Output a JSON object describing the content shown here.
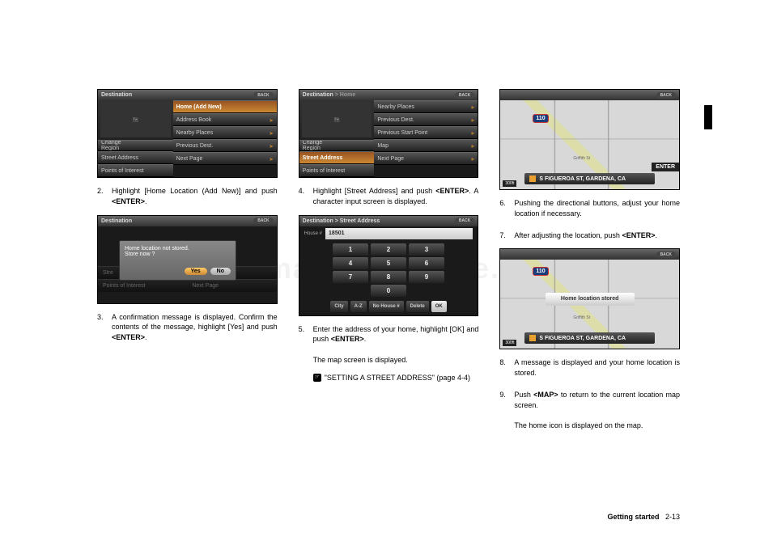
{
  "watermark": "carmanualsonline.info",
  "footer": {
    "section": "Getting started",
    "page": "2-13"
  },
  "col1": {
    "screenshot1": {
      "header_title": "Destination",
      "back": "BACK",
      "left_label": "Change\nRegion",
      "left_bottom1": "Street Address",
      "left_bottom2": "Points of Interest",
      "right": [
        "Home (Add New)",
        "Address Book",
        "Nearby Places",
        "Previous Dest.",
        "Next Page"
      ]
    },
    "step2": {
      "num": "2.",
      "txt_a": "Highlight [Home Location (Add New)] and push ",
      "btn": "<ENTER>",
      "txt_b": "."
    },
    "screenshot2": {
      "header_title": "Destination",
      "back": "BACK",
      "msg1": "Home location not stored.",
      "msg2": "Store now ?",
      "yes": "Yes",
      "no": "No",
      "dim1": "Stre",
      "dim2": "Points of Interest",
      "dim3": "Next Page"
    },
    "step3": {
      "num": "3.",
      "txt_a": "A confirmation message is displayed. Confirm the contents of the message, highlight [Yes] and push ",
      "btn": "<ENTER>",
      "txt_b": "."
    }
  },
  "col2": {
    "screenshot1": {
      "header_title_a": "Destination",
      "header_title_b": " > Home",
      "back": "BACK",
      "left_label": "Change\nRegion",
      "left_bottom1": "Street Address",
      "left_bottom2": "Points of Interest",
      "right": [
        "Nearby Places",
        "Previous Dest.",
        "Previous Start Point",
        "Map",
        "Next Page"
      ]
    },
    "step4": {
      "num": "4.",
      "txt_a": "Highlight [Street Address] and push ",
      "btn": "<ENTER>",
      "txt_b": ". A character input screen is displayed."
    },
    "screenshot2": {
      "header": "Destination > Street Address",
      "back": "BACK",
      "house_label": "House #",
      "house_value": "18501",
      "keys": [
        [
          "1",
          "2",
          "3"
        ],
        [
          "4",
          "5",
          "6"
        ],
        [
          "7",
          "8",
          "9"
        ],
        [
          "",
          "0",
          ""
        ]
      ],
      "bottom": [
        "City",
        "A-Z",
        "No House #",
        "Delete",
        "OK"
      ]
    },
    "step5": {
      "num": "5.",
      "txt_a": "Enter the address of your home, highlight [OK] and push ",
      "btn": "<ENTER>",
      "txt_b": "."
    },
    "step5_sub1": "The map screen is displayed.",
    "step5_ref": "\"SETTING A STREET ADDRESS\" (page 4-4)"
  },
  "col3": {
    "screenshot1": {
      "back": "BACK",
      "shield": "110",
      "street": "S FIGUEROA ST, GARDENA, CA",
      "enter": "ENTER",
      "scale": "300ft",
      "grif": "Griffith St"
    },
    "step6": {
      "num": "6.",
      "txt": "Pushing the directional buttons, adjust your home location if necessary."
    },
    "step7": {
      "num": "7.",
      "txt_a": "After adjusting the location, push ",
      "btn": "<ENTER>",
      "txt_b": "."
    },
    "screenshot2": {
      "back": "BACK",
      "shield": "110",
      "msg": "Home location stored",
      "street": "S FIGUEROA ST, GARDENA, CA",
      "scale": "300ft",
      "grif": "Griffith St"
    },
    "step8": {
      "num": "8.",
      "txt": "A message is displayed and your home location is stored."
    },
    "step9": {
      "num": "9.",
      "txt_a": "Push ",
      "btn": "<MAP>",
      "txt_b": " to return to the current location map screen."
    },
    "step9_sub": "The home icon is displayed on the map."
  }
}
